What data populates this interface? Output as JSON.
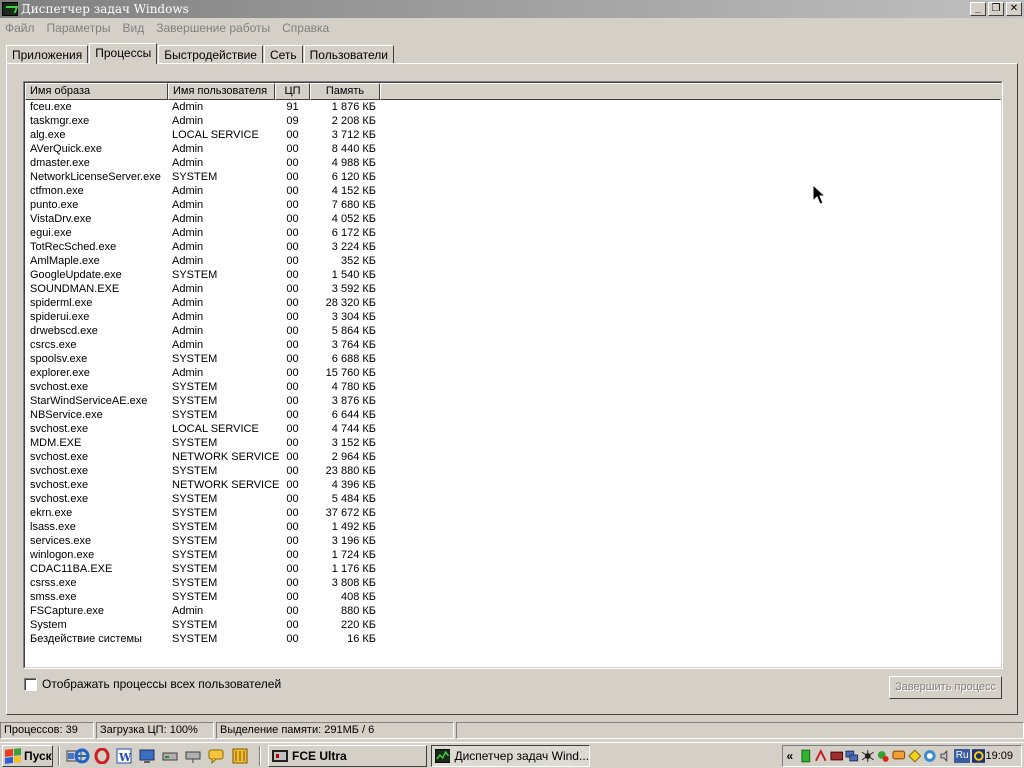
{
  "window": {
    "title": "Диспетчер задач Windows"
  },
  "menu": [
    "Файл",
    "Параметры",
    "Вид",
    "Завершение работы",
    "Справка"
  ],
  "tabs": [
    "Приложения",
    "Процессы",
    "Быстродействие",
    "Сеть",
    "Пользователи"
  ],
  "active_tab": "Процессы",
  "columns": {
    "name": "Имя образа",
    "user": "Имя пользователя",
    "cpu": "ЦП",
    "mem": "Память"
  },
  "processes": [
    [
      "fceu.exe",
      "Admin",
      "91",
      "1 876 КБ"
    ],
    [
      "taskmgr.exe",
      "Admin",
      "09",
      "2 208 КБ"
    ],
    [
      "alg.exe",
      "LOCAL SERVICE",
      "00",
      "3 712 КБ"
    ],
    [
      "AVerQuick.exe",
      "Admin",
      "00",
      "8 440 КБ"
    ],
    [
      "dmaster.exe",
      "Admin",
      "00",
      "4 988 КБ"
    ],
    [
      "NetworkLicenseServer.exe",
      "SYSTEM",
      "00",
      "6 120 КБ"
    ],
    [
      "ctfmon.exe",
      "Admin",
      "00",
      "4 152 КБ"
    ],
    [
      "punto.exe",
      "Admin",
      "00",
      "7 680 КБ"
    ],
    [
      "VistaDrv.exe",
      "Admin",
      "00",
      "4 052 КБ"
    ],
    [
      "egui.exe",
      "Admin",
      "00",
      "6 172 КБ"
    ],
    [
      "TotRecSched.exe",
      "Admin",
      "00",
      "3 224 КБ"
    ],
    [
      "AmlMaple.exe",
      "Admin",
      "00",
      "352 КБ"
    ],
    [
      "GoogleUpdate.exe",
      "SYSTEM",
      "00",
      "1 540 КБ"
    ],
    [
      "SOUNDMAN.EXE",
      "Admin",
      "00",
      "3 592 КБ"
    ],
    [
      "spiderml.exe",
      "Admin",
      "00",
      "28 320 КБ"
    ],
    [
      "spiderui.exe",
      "Admin",
      "00",
      "3 304 КБ"
    ],
    [
      "drwebscd.exe",
      "Admin",
      "00",
      "5 864 КБ"
    ],
    [
      "csrcs.exe",
      "Admin",
      "00",
      "3 764 КБ"
    ],
    [
      "spoolsv.exe",
      "SYSTEM",
      "00",
      "6 688 КБ"
    ],
    [
      "explorer.exe",
      "Admin",
      "00",
      "15 760 КБ"
    ],
    [
      "svchost.exe",
      "SYSTEM",
      "00",
      "4 780 КБ"
    ],
    [
      "StarWindServiceAE.exe",
      "SYSTEM",
      "00",
      "3 876 КБ"
    ],
    [
      "NBService.exe",
      "SYSTEM",
      "00",
      "6 644 КБ"
    ],
    [
      "svchost.exe",
      "LOCAL SERVICE",
      "00",
      "4 744 КБ"
    ],
    [
      "MDM.EXE",
      "SYSTEM",
      "00",
      "3 152 КБ"
    ],
    [
      "svchost.exe",
      "NETWORK SERVICE",
      "00",
      "2 964 КБ"
    ],
    [
      "svchost.exe",
      "SYSTEM",
      "00",
      "23 880 КБ"
    ],
    [
      "svchost.exe",
      "NETWORK SERVICE",
      "00",
      "4 396 КБ"
    ],
    [
      "svchost.exe",
      "SYSTEM",
      "00",
      "5 484 КБ"
    ],
    [
      "ekrn.exe",
      "SYSTEM",
      "00",
      "37 672 КБ"
    ],
    [
      "lsass.exe",
      "SYSTEM",
      "00",
      "1 492 КБ"
    ],
    [
      "services.exe",
      "SYSTEM",
      "00",
      "3 196 КБ"
    ],
    [
      "winlogon.exe",
      "SYSTEM",
      "00",
      "1 724 КБ"
    ],
    [
      "CDAC11BA.EXE",
      "SYSTEM",
      "00",
      "1 176 КБ"
    ],
    [
      "csrss.exe",
      "SYSTEM",
      "00",
      "3 808 КБ"
    ],
    [
      "smss.exe",
      "SYSTEM",
      "00",
      "408 КБ"
    ],
    [
      "FSCapture.exe",
      "Admin",
      "00",
      "880 КБ"
    ],
    [
      "System",
      "SYSTEM",
      "00",
      "220 КБ"
    ],
    [
      "Бездействие системы",
      "SYSTEM",
      "00",
      "16 КБ"
    ]
  ],
  "show_all_label": "Отображать процессы всех пользователей",
  "end_process_label": "Завершить процесс",
  "status": {
    "processes": "Процессов: 39",
    "cpu": "Загрузка ЦП: 100%",
    "memory": "Выделение памяти: 291МБ / 6"
  },
  "taskbar": {
    "start_label": "Пуск",
    "tasks": [
      "FCE Ultra",
      "Диспетчер задач Wind..."
    ],
    "lang": "Ru",
    "clock": "19:09"
  },
  "colors": {
    "titlebar_start": "#808080",
    "titlebar_end": "#c0c0c0",
    "face": "#d4d0c8"
  }
}
